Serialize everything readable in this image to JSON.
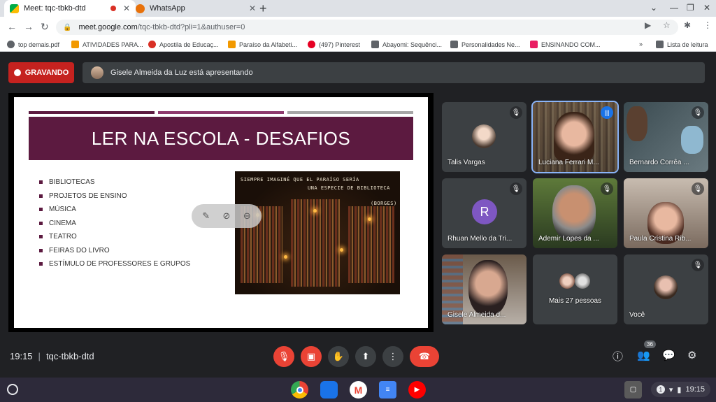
{
  "browser": {
    "tabs": [
      {
        "title": "Meet: tqc-tbkb-dtd",
        "favicon_color": "#00ac47",
        "active": true
      },
      {
        "title": "WhatsApp",
        "favicon_color": "#e8710a",
        "active": false
      }
    ],
    "url_host": "meet.google.com",
    "url_path": "/tqc-tbkb-dtd?pli=1&authuser=0",
    "bookmarks": [
      {
        "label": "top demais.pdf",
        "icon_color": "#5f6368"
      },
      {
        "label": "ATIVIDADES PARA...",
        "icon_color": "#f29900"
      },
      {
        "label": "Apostila de Educaç...",
        "icon_color": "#d93025"
      },
      {
        "label": "Paraíso da Alfabeti...",
        "icon_color": "#f29900"
      },
      {
        "label": "(497) Pinterest",
        "icon_color": "#e60023"
      },
      {
        "label": "Abayomi: Sequênci...",
        "icon_color": "#5f6368"
      },
      {
        "label": "Personalidades Ne...",
        "icon_color": "#5f6368"
      },
      {
        "label": "ENSINANDO COM...",
        "icon_color": "#e91e63"
      }
    ],
    "reading_list": "Lista de leitura",
    "more": "»"
  },
  "meet": {
    "recording_label": "GRAVANDO",
    "presenting_text": "Gisele Almeida da Luz está apresentando",
    "slide": {
      "title": "LER NA ESCOLA - DESAFIOS",
      "bar_colors": [
        "#5c1a40",
        "#8e3a6e",
        "#a6a6a6"
      ],
      "bullets": [
        "BIBLIOTECAS",
        "PROJETOS DE ENSINO",
        "MÚSICA",
        "CINEMA",
        "TEATRO",
        "FEIRAS DO LIVRO",
        "ESTÍMULO DE PROFESSORES E GRUPOS"
      ],
      "image_text_1": "SIEMPRE IMAGINÉ QUE EL PARAÍSO SERÍA",
      "image_text_2": "UNA ESPECIE DE BIBLIOTECA",
      "image_text_3": "(BORGES)"
    },
    "participants": [
      {
        "name": "Talis Vargas",
        "muted": true
      },
      {
        "name": "Luciana Ferrari M...",
        "muted": false,
        "speaking": true
      },
      {
        "name": "Bernardo Corrêa ...",
        "muted": true
      },
      {
        "name": "Rhuan Mello da Tri...",
        "muted": true,
        "initial": "R"
      },
      {
        "name": "Ademir Lopes da ...",
        "muted": true
      },
      {
        "name": "Paula Cristina Rib...",
        "muted": true
      },
      {
        "name": "Gisele Almeida d...",
        "muted": false
      },
      {
        "name": "Mais 27 pessoas",
        "muted": false
      },
      {
        "name": "Você",
        "muted": true
      }
    ],
    "time": "19:15",
    "meeting_code": "tqc-tbkb-dtd",
    "separator": "|",
    "people_count": "36"
  },
  "os": {
    "clock": "19:15",
    "notification_count": "1"
  }
}
